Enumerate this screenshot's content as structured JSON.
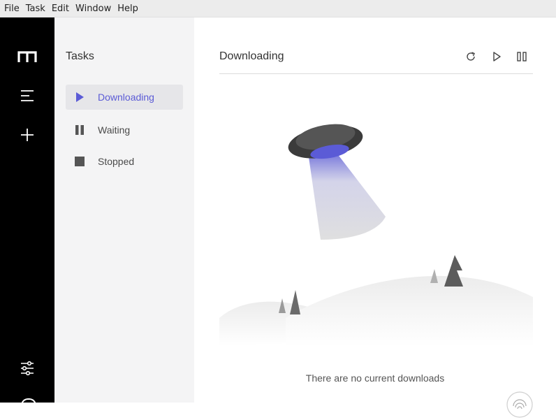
{
  "menu": [
    "File",
    "Task",
    "Edit",
    "Window",
    "Help"
  ],
  "rail": {
    "icons": [
      "app-logo-icon",
      "menu-lines-icon",
      "add-icon",
      "preferences-sliders-icon"
    ]
  },
  "sidebar": {
    "title": "Tasks",
    "items": [
      {
        "label": "Downloading",
        "icon": "play-icon",
        "active": true
      },
      {
        "label": "Waiting",
        "icon": "pause-icon",
        "active": false
      },
      {
        "label": "Stopped",
        "icon": "stop-icon",
        "active": false
      }
    ]
  },
  "main": {
    "title": "Downloading",
    "actions": [
      "refresh-icon",
      "resume-all-icon",
      "pause-all-icon"
    ],
    "empty_message": "There are no current downloads"
  },
  "colors": {
    "accent": "#5b5bd6",
    "rail": "#000000",
    "panel": "#f4f4f5"
  }
}
